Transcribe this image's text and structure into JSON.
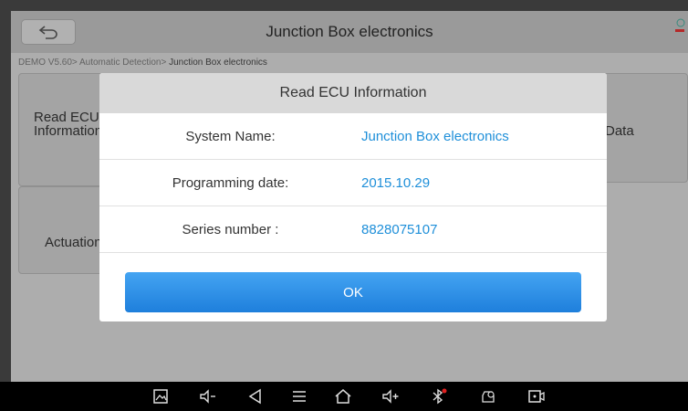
{
  "header": {
    "title": "Junction Box electronics",
    "back_icon": "back-arrow-icon"
  },
  "breadcrumb": {
    "path": "DEMO V5.60> Automatic Detection> ",
    "current": "Junction Box electronics"
  },
  "tiles": {
    "read_ecu_line1": "Read ECU",
    "read_ecu_line2": "Information",
    "actuation": "Actuation",
    "data": "Data"
  },
  "dialog": {
    "title": "Read ECU Information",
    "rows": [
      {
        "label": "System Name:",
        "value": "Junction Box electronics"
      },
      {
        "label": "Programming date:",
        "value": "2015.10.29"
      },
      {
        "label": "Series number :",
        "value": "8828075107"
      }
    ],
    "ok_label": "OK"
  },
  "navbar": {
    "icons": [
      "screenshot-icon",
      "volume-down-icon",
      "back-icon",
      "menu-icon",
      "home-icon",
      "volume-up-icon",
      "bluetooth-icon",
      "vci-icon",
      "screen-record-icon"
    ]
  },
  "colors": {
    "accent": "#1e8fd9",
    "button": "#2f8fe6"
  }
}
